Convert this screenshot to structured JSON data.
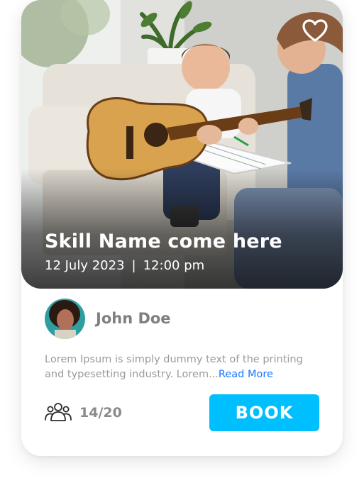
{
  "skill": {
    "title": "Skill Name come here",
    "date": "12 July 2023",
    "separator": "|",
    "time": "12:00 pm"
  },
  "host": {
    "name": "John Doe"
  },
  "description": {
    "text": "Lorem Ipsum is simply dummy text of the printing and typesetting industry. Lorem...",
    "read_more": "Read More"
  },
  "participants": {
    "count": "14/20"
  },
  "actions": {
    "book_label": "BOOK"
  },
  "colors": {
    "accent": "#00bfff",
    "link": "#1976ff",
    "muted_text": "#9a9a9a"
  },
  "icons": {
    "favorite": "heart-icon",
    "participants": "people-icon"
  }
}
